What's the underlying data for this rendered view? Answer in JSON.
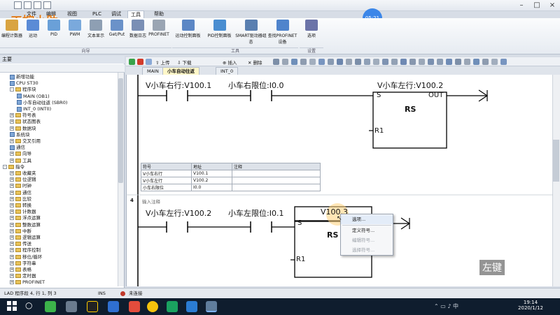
{
  "menu": {
    "items": [
      "文件",
      "编辑",
      "视图",
      "PLC",
      "调试",
      "工具",
      "帮助"
    ],
    "active": "工具"
  },
  "logo_text": "工控小助",
  "timer": "05:21",
  "ribbon": {
    "buttons_left": [
      "编程计数器",
      "运动",
      "PID",
      "PWM",
      "文本显示",
      "Get/Put",
      "数据日志",
      "PROFINET"
    ],
    "group1_label": "向导",
    "buttons_mid": [
      "运动控制面板",
      "PID控制面板",
      "SMART驱动器组态",
      "查找PROFINET设备"
    ],
    "group2_label": "工具",
    "buttons_right": [
      "选项"
    ],
    "group3_label": "设置"
  },
  "left_panel": {
    "title": "主要",
    "tree": [
      {
        "label": "新增功能",
        "level": 1,
        "icon": "gear"
      },
      {
        "label": "CPU ST30",
        "level": 1,
        "icon": "gear"
      },
      {
        "label": "程序块",
        "level": 1,
        "icon": "folder",
        "exp": "-"
      },
      {
        "label": "MAIN (OB1)",
        "level": 2,
        "icon": "gear"
      },
      {
        "label": "小车自动往返 (SBR0)",
        "level": 2,
        "icon": "gear"
      },
      {
        "label": "INT_0 (INT0)",
        "level": 2,
        "icon": "gear"
      },
      {
        "label": "符号表",
        "level": 1,
        "icon": "folder",
        "exp": "+"
      },
      {
        "label": "状态图表",
        "level": 1,
        "icon": "folder",
        "exp": "+"
      },
      {
        "label": "数据块",
        "level": 1,
        "icon": "folder",
        "exp": "+"
      },
      {
        "label": "系统块",
        "level": 1,
        "icon": "gear"
      },
      {
        "label": "交叉引用",
        "level": 1,
        "icon": "folder",
        "exp": "+"
      },
      {
        "label": "通信",
        "level": 1,
        "icon": "gear"
      },
      {
        "label": "向导",
        "level": 1,
        "icon": "folder",
        "exp": "+"
      },
      {
        "label": "工具",
        "level": 1,
        "icon": "folder",
        "exp": "+"
      },
      {
        "label": "指令",
        "level": 0,
        "icon": "folder",
        "exp": "-"
      },
      {
        "label": "收藏夹",
        "level": 1,
        "icon": "folder",
        "exp": "+"
      },
      {
        "label": "位逻辑",
        "level": 1,
        "icon": "folder",
        "exp": "+"
      },
      {
        "label": "时钟",
        "level": 1,
        "icon": "folder",
        "exp": "+"
      },
      {
        "label": "通信",
        "level": 1,
        "icon": "folder",
        "exp": "+"
      },
      {
        "label": "比较",
        "level": 1,
        "icon": "folder",
        "exp": "+"
      },
      {
        "label": "转换",
        "level": 1,
        "icon": "folder",
        "exp": "+"
      },
      {
        "label": "计数器",
        "level": 1,
        "icon": "folder",
        "exp": "+"
      },
      {
        "label": "浮点运算",
        "level": 1,
        "icon": "folder",
        "exp": "+"
      },
      {
        "label": "整数运算",
        "level": 1,
        "icon": "folder",
        "exp": "+"
      },
      {
        "label": "中断",
        "level": 1,
        "icon": "folder",
        "exp": "+"
      },
      {
        "label": "逻辑运算",
        "level": 1,
        "icon": "folder",
        "exp": "+"
      },
      {
        "label": "传送",
        "level": 1,
        "icon": "folder",
        "exp": "+"
      },
      {
        "label": "程序控制",
        "level": 1,
        "icon": "folder",
        "exp": "+"
      },
      {
        "label": "移位/循环",
        "level": 1,
        "icon": "folder",
        "exp": "+"
      },
      {
        "label": "字符串",
        "level": 1,
        "icon": "folder",
        "exp": "+"
      },
      {
        "label": "表格",
        "level": 1,
        "icon": "folder",
        "exp": "+"
      },
      {
        "label": "定时器",
        "level": 1,
        "icon": "folder",
        "exp": "+"
      },
      {
        "label": "PROFINET",
        "level": 1,
        "icon": "folder",
        "exp": "+"
      }
    ]
  },
  "editor_toolbar": {
    "upload": "上传",
    "download": "下载",
    "insert": "插入",
    "delete": "删除"
  },
  "tabs": [
    "MAIN",
    "小车自动往返",
    "INT_0"
  ],
  "active_tab": "小车自动往返",
  "rung3": {
    "contact1": "V小车右行:V100.1",
    "contact2": "小车右限位:I0.0",
    "coil_addr": "V小车左行:V100.2",
    "block_type": "RS",
    "pin_s": "S",
    "pin_out": "OUT",
    "pin_r1": "R1"
  },
  "symbol_table": {
    "headers": [
      "符号",
      "地址",
      "注释"
    ],
    "rows": [
      [
        "V小车右行",
        "V100.1",
        ""
      ],
      [
        "V小车左行",
        "V100.2",
        ""
      ],
      [
        "小车右限位",
        "I0.0",
        ""
      ]
    ]
  },
  "rung4": {
    "number": "4",
    "comment": "输入注释",
    "contact1": "V小车左行:V100.2",
    "contact2": "小车左限位:I0.1",
    "coil_addr": "V100.3",
    "block_type": "RS",
    "pin_s": "S",
    "pin_r1": "R1"
  },
  "context_menu": {
    "items": [
      {
        "label": "选项...",
        "disabled": false
      },
      {
        "label": "定义符号...",
        "disabled": false
      },
      {
        "label": "编辑符号...",
        "disabled": true
      },
      {
        "label": "选择符号...",
        "disabled": true
      }
    ]
  },
  "watermark": "左键",
  "status": {
    "position": "LAD 程序段 4, 行 1, 列 3",
    "mode": "INS",
    "connection": "未连接"
  },
  "taskbar": {
    "time": "19:14",
    "date": "2020/1/12"
  }
}
